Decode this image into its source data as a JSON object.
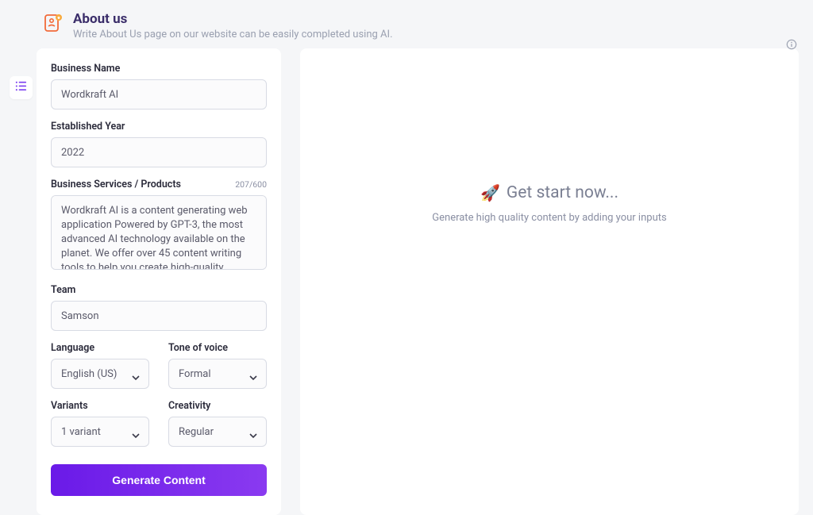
{
  "header": {
    "title": "About us",
    "subtitle": "Write About Us page on our website can be easily completed using AI."
  },
  "form": {
    "business_name": {
      "label": "Business Name",
      "value": "Wordkraft AI"
    },
    "established_year": {
      "label": "Established Year",
      "value": "2022"
    },
    "services": {
      "label": "Business Services / Products",
      "counter": "207/600",
      "value": "Wordkraft AI is a content generating web application Powered by GPT-3, the most advanced AI technology available on the planet. We offer over 45 content writing tools to help you create high-quality content."
    },
    "team": {
      "label": "Team",
      "value": "Samson"
    },
    "language": {
      "label": "Language",
      "value": "English (US)"
    },
    "tone": {
      "label": "Tone of voice",
      "value": "Formal"
    },
    "variants": {
      "label": "Variants",
      "value": "1 variant"
    },
    "creativity": {
      "label": "Creativity",
      "value": "Regular"
    },
    "button": "Generate Content"
  },
  "output": {
    "rocket": "🚀",
    "title": "Get start now...",
    "subtitle": "Generate high quality content by adding your inputs"
  }
}
